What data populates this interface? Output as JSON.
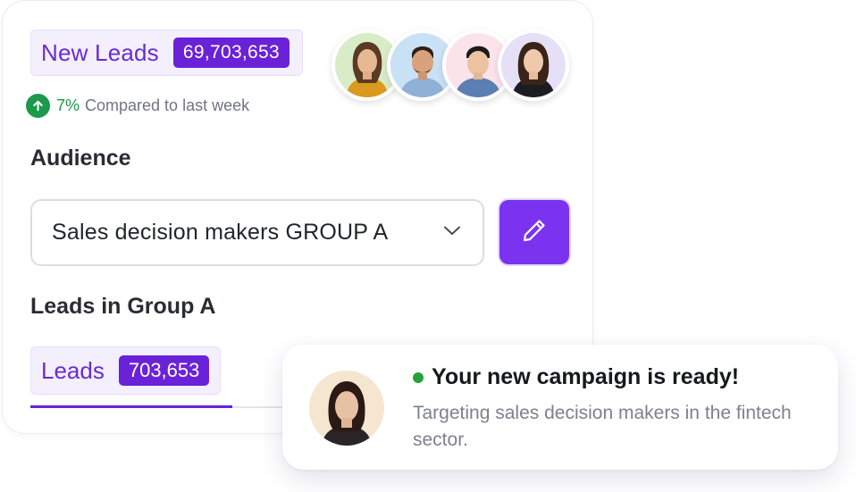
{
  "metric": {
    "label": "New Leads",
    "value": "69,703,653",
    "trend_percent": "7%",
    "trend_text": "Compared to last week"
  },
  "avatars": [
    {
      "icon": "person-avatar-icon",
      "bg": "#d9ecc8"
    },
    {
      "icon": "person-avatar-icon",
      "bg": "#c9e1f5"
    },
    {
      "icon": "person-avatar-icon",
      "bg": "#fbe3ea"
    },
    {
      "icon": "person-avatar-icon",
      "bg": "#e6e0f7"
    }
  ],
  "audience": {
    "title": "Audience",
    "selected": "Sales decision makers GROUP A",
    "dropdown_icon": "chevron-down-icon",
    "edit_icon": "pencil-icon"
  },
  "group": {
    "title": "Leads in Group A",
    "label": "Leads",
    "value": "703,653"
  },
  "notification": {
    "title": "Your new campaign is ready!",
    "body": "Targeting sales decision makers in the fintech sector.",
    "status_color": "#23a33b"
  },
  "colors": {
    "accent": "#6a22d8",
    "button": "#7b33f0",
    "success": "#1a9a4a"
  }
}
